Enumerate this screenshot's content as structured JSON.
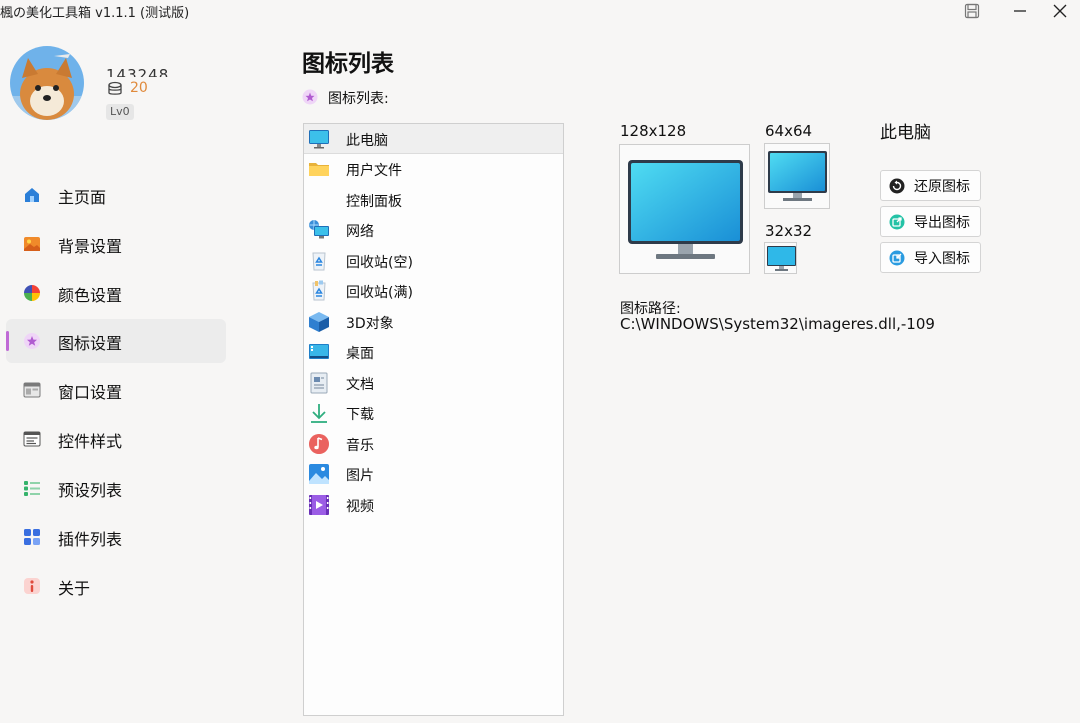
{
  "window": {
    "title": "楓の美化工具箱 v1.1.1 (测试版)",
    "controls": [
      "save-icon",
      "minimize-icon",
      "close-icon"
    ]
  },
  "profile": {
    "username": "143248",
    "coins": "20",
    "level": "Lv0"
  },
  "sidebar": {
    "items": [
      {
        "label": "主页面",
        "icon": "home-icon"
      },
      {
        "label": "背景设置",
        "icon": "image-icon"
      },
      {
        "label": "颜色设置",
        "icon": "color-wheel-icon"
      },
      {
        "label": "图标设置",
        "icon": "star-icon",
        "active": true
      },
      {
        "label": "窗口设置",
        "icon": "window-icon"
      },
      {
        "label": "控件样式",
        "icon": "control-icon"
      },
      {
        "label": "预设列表",
        "icon": "list-icon"
      },
      {
        "label": "插件列表",
        "icon": "plugin-icon"
      },
      {
        "label": "关于",
        "icon": "info-icon"
      }
    ],
    "accent": "#c06ad6"
  },
  "main": {
    "title": "图标列表",
    "list_caption": "图标列表:",
    "icon_list": [
      {
        "label": "此电脑",
        "icon": "monitor-icon",
        "selected": true
      },
      {
        "label": "用户文件",
        "icon": "folder-icon"
      },
      {
        "label": "控制面板",
        "icon": ""
      },
      {
        "label": "网络",
        "icon": "network-icon"
      },
      {
        "label": "回收站(空)",
        "icon": "recycle-bin-empty-icon"
      },
      {
        "label": "回收站(满)",
        "icon": "recycle-bin-full-icon"
      },
      {
        "label": "3D对象",
        "icon": "cube-icon"
      },
      {
        "label": "桌面",
        "icon": "desktop-icon"
      },
      {
        "label": "文档",
        "icon": "document-icon"
      },
      {
        "label": "下载",
        "icon": "download-icon"
      },
      {
        "label": "音乐",
        "icon": "music-icon"
      },
      {
        "label": "图片",
        "icon": "picture-icon"
      },
      {
        "label": "视频",
        "icon": "video-icon"
      }
    ],
    "preview": {
      "size_large": "128x128",
      "size_medium": "64x64",
      "size_small": "32x32",
      "selected_name": "此电脑",
      "buttons": {
        "restore": "还原图标",
        "export": "导出图标",
        "import": "导入图标"
      },
      "path_label": "图标路径:",
      "path_value": "C:\\WINDOWS\\System32\\imageres.dll,-109"
    }
  }
}
